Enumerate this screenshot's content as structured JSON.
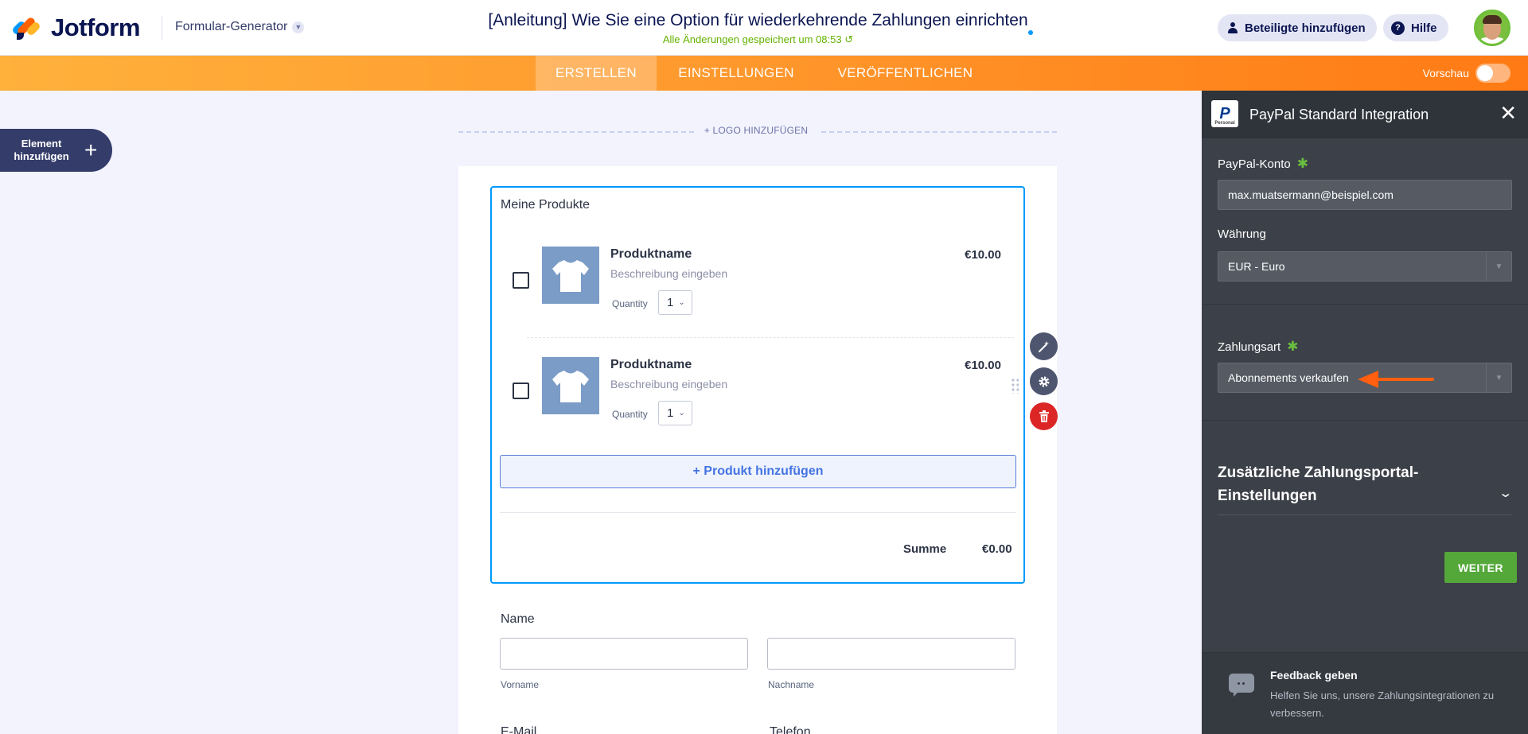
{
  "header": {
    "brand": "Jotform",
    "builder_label": "Formular-Generator",
    "form_title": "[Anleitung] Wie Sie eine Option für wiederkehrende Zahlungen einrichten",
    "save_status": "Alle Änderungen gespeichert um 08:53",
    "invite_label": "Beteiligte hinzufügen",
    "help_label": "Hilfe"
  },
  "nav": {
    "tabs": [
      "ERSTELLEN",
      "EINSTELLUNGEN",
      "VERÖFFENTLICHEN"
    ],
    "active_tab": "ERSTELLEN",
    "preview_label": "Vorschau",
    "preview_enabled": false
  },
  "left": {
    "add_element_label": "Element hinzufügen"
  },
  "canvas": {
    "logo_add_label": "+ LOGO HINZUFÜGEN",
    "product_widget": {
      "title": "Meine Produkte",
      "products": [
        {
          "name": "Produktname",
          "description": "Beschreibung eingeben",
          "quantity_label": "Quantity",
          "quantity": "1",
          "price": "€10.00"
        },
        {
          "name": "Produktname",
          "description": "Beschreibung eingeben",
          "quantity_label": "Quantity",
          "quantity": "1",
          "price": "€10.00"
        }
      ],
      "add_product_label": "+ Produkt hinzufügen",
      "sum_label": "Summe",
      "sum_value": "€0.00"
    },
    "name_field": {
      "label": "Name",
      "first_sublabel": "Vorname",
      "last_sublabel": "Nachname"
    },
    "cut_labels": [
      "E-Mail",
      "Telefon"
    ]
  },
  "panel": {
    "title": "PayPal Standard Integration",
    "paypal_logo_text": "P",
    "paypal_logo_sub": "Personal",
    "account_label": "PayPal-Konto",
    "account_value": "max.muatsermann@beispiel.com",
    "currency_label": "Währung",
    "currency_value": "EUR - Euro",
    "payment_type_label": "Zahlungsart",
    "payment_type_value": "Abonnements verkaufen",
    "extra_settings_title": "Zusätzliche Zahlungsportal-Einstellungen",
    "next_button": "WEITER",
    "feedback_title": "Feedback geben",
    "feedback_text": "Helfen Sie uns, unsere Zahlungsintegrationen zu verbessern."
  },
  "colors": {
    "accent_orange": "#ff7a14",
    "selection_blue": "#0099ff",
    "panel_bg": "#3c4048",
    "success_green": "#54a83a",
    "annotation_arrow": "#ff5f0e"
  },
  "icons": [
    "jotform-logo-icon",
    "chevron-down-icon",
    "user-icon",
    "help-icon",
    "plus-icon",
    "tshirt-icon",
    "magic-wand-icon",
    "gear-icon",
    "trash-icon",
    "close-icon",
    "paypal-icon",
    "chat-bubble-icon"
  ]
}
